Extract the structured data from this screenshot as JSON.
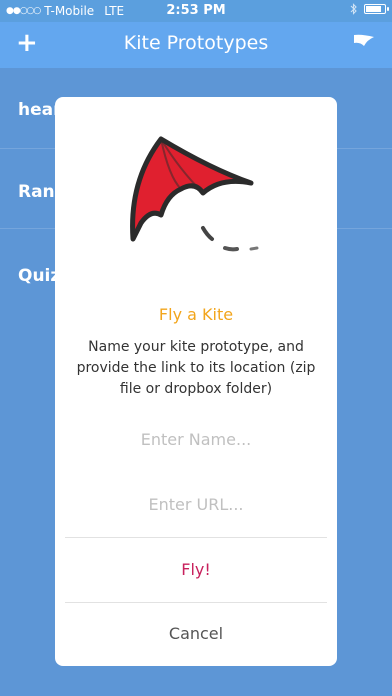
{
  "status": {
    "carrier": "T-Mobile",
    "network": "LTE",
    "time": "2:53 PM",
    "signal_icon": "signal-dots-icon",
    "bluetooth_icon": "bluetooth-icon",
    "battery_icon": "battery-icon"
  },
  "nav": {
    "title": "Kite Prototypes",
    "add_icon": "plus-icon",
    "flag_icon": "flag-icon"
  },
  "list": {
    "items": [
      {
        "label": "hear"
      },
      {
        "label": "Ranc"
      },
      {
        "label": "Quiz"
      }
    ]
  },
  "dialog": {
    "title": "Fly a Kite",
    "message": "Name your kite prototype, and provide the link to its location (zip file or dropbox folder)",
    "name_placeholder": "Enter Name...",
    "url_placeholder": "Enter URL...",
    "fly_label": "Fly!",
    "cancel_label": "Cancel",
    "kite_icon": "kite-icon"
  },
  "colors": {
    "nav_bg": "#63a7ef",
    "list_bg": "#5d96d6",
    "title_accent": "#f2a51c",
    "fly_accent": "#c8215d",
    "kite_red": "#e0202f"
  }
}
